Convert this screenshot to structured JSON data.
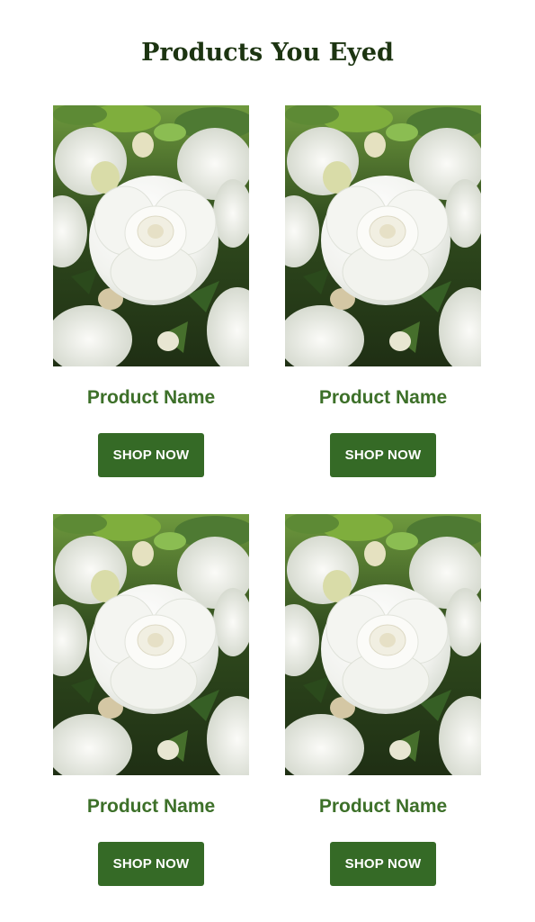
{
  "header": {
    "title": "Products You Eyed"
  },
  "products": [
    {
      "name": "Product Name",
      "button_label": "SHOP NOW"
    },
    {
      "name": "Product Name",
      "button_label": "SHOP NOW"
    },
    {
      "name": "Product Name",
      "button_label": "SHOP NOW"
    },
    {
      "name": "Product Name",
      "button_label": "SHOP NOW"
    }
  ],
  "colors": {
    "heading": "#1c3411",
    "product_name": "#3d7029",
    "button_bg": "#356a26",
    "button_text": "#ffffff"
  }
}
